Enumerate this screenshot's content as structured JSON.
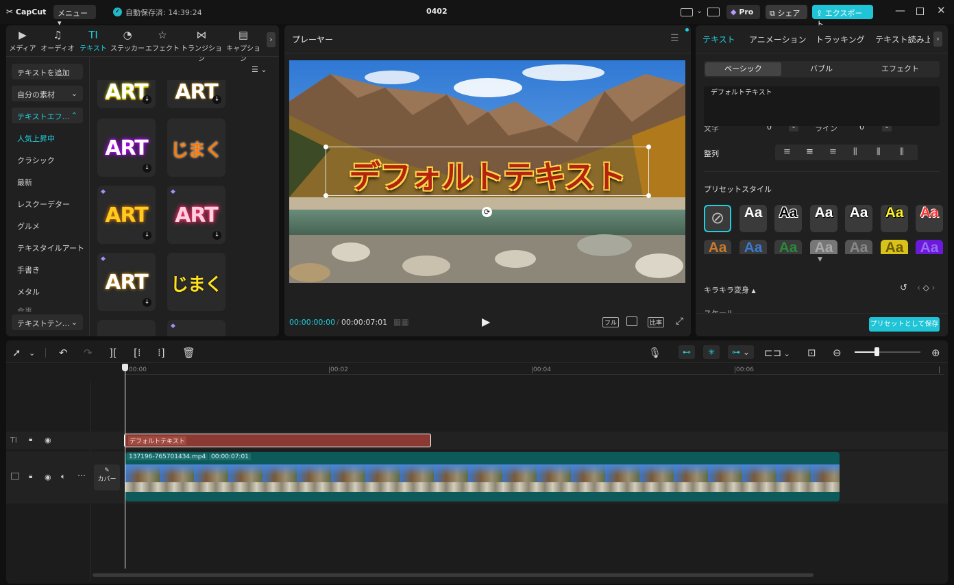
{
  "app": {
    "logo": "CapCut",
    "menu": "メニュー",
    "autosave": "自動保存済: 14:39:24",
    "project": "0402",
    "pro": "Pro",
    "share": "シェア",
    "export": "エクスポート"
  },
  "media_tabs": [
    {
      "label": "メディア",
      "icon": "media-icon",
      "active": false
    },
    {
      "label": "オーディオ",
      "icon": "audio-icon",
      "active": false
    },
    {
      "label": "テキスト",
      "icon": "text-icon",
      "active": true
    },
    {
      "label": "ステッカー",
      "icon": "sticker-icon",
      "active": false
    },
    {
      "label": "エフェクト",
      "icon": "effect-icon",
      "active": false
    },
    {
      "label": "トランジション",
      "icon": "transition-icon",
      "active": false
    },
    {
      "label": "キャプション",
      "icon": "caption-icon",
      "active": false
    }
  ],
  "sidebar": {
    "add_text": "テキストを追加",
    "my_material": "自分の素材",
    "text_effects": "テキストエフ…",
    "items": [
      "人気上昇中",
      "クラシック",
      "最新",
      "レスクーデター",
      "グルメ",
      "テキスタイルアート",
      "手書き",
      "メタル",
      "食事"
    ],
    "template": "テキストテン…"
  },
  "thumbs": {
    "art": "ART",
    "jimaku": "じまく"
  },
  "player": {
    "title": "プレーヤー",
    "overlay_text": "デフォルトテキスト",
    "time_current": "00:00:00:00",
    "time_total": "00:00:07:01",
    "full": "フル",
    "ratio": "比率"
  },
  "right": {
    "tabs": [
      "テキスト",
      "アニメーション",
      "トラッキング",
      "テキスト読み上"
    ],
    "subtabs": [
      "ベーシック",
      "バブル",
      "エフェクト"
    ],
    "text_value": "デフォルトテキスト",
    "char_label": "文字",
    "char_value": "0",
    "line_label": "ライン",
    "line_value": "0",
    "align_label": "整列",
    "preset_label": "プリセットスタイル",
    "preset_glyph": "Aa",
    "sparkle": "キラキラ変身",
    "scale": "スケール",
    "save_preset": "プリセットとして保存"
  },
  "timeline": {
    "ticks": [
      "00:00",
      "00:02",
      "00:04",
      "00:06"
    ],
    "text_clip": "デフォルトテキスト",
    "video_name": "137196-765701434.mp4",
    "video_dur": "00:00:07:01",
    "cover": "カバー"
  }
}
